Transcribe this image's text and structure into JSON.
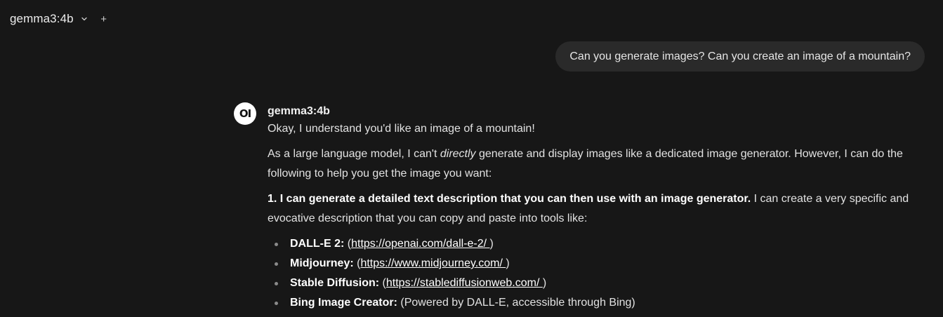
{
  "header": {
    "model_name": "gemma3:4b",
    "chevron_icon": "chevron-down-icon",
    "plus_icon": "plus-icon",
    "plus_glyph": "+"
  },
  "user_message": {
    "text": "Can you generate images? Can you create an image of a mountain?"
  },
  "assistant_message": {
    "avatar_text": "OI",
    "sender": "gemma3:4b",
    "p1": "Okay, I understand you'd like an image of a mountain!",
    "p2": {
      "before": "As a large language model, I can't ",
      "emphasis": "directly",
      "after": " generate and display images like a dedicated image generator. However, I can do the following to help you get the image you want:"
    },
    "p3": {
      "bold": "1. I can generate a detailed text description that you can then use with an image generator.",
      "rest": " I can create a very specific and evocative description that you can copy and paste into tools like:"
    },
    "tools": [
      {
        "name": "DALL-E 2:",
        "open": " (",
        "link": "https://openai.com/dall-e-2/ ",
        "close": ")",
        "note": ""
      },
      {
        "name": "Midjourney:",
        "open": " (",
        "link": "https://www.midjourney.com/ ",
        "close": ")",
        "note": ""
      },
      {
        "name": "Stable Diffusion:",
        "open": " (",
        "link": "https://stablediffusionweb.com/ ",
        "close": ")",
        "note": ""
      },
      {
        "name": "Bing Image Creator:",
        "open": "",
        "link": "",
        "close": "",
        "note": " (Powered by DALL-E, accessible through Bing)"
      }
    ]
  },
  "colors": {
    "background": "#171717",
    "user_bubble": "#2a2a2a",
    "text": "#e2e2e2"
  }
}
